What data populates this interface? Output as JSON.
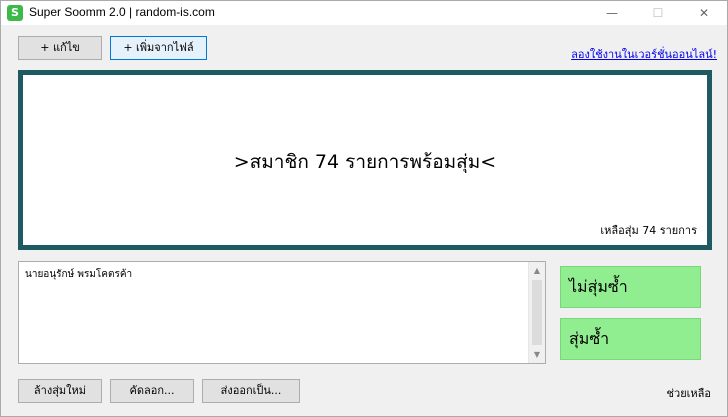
{
  "window": {
    "title": "Super Soomm 2.0 | random-is.com",
    "app_icon_glyph": "S",
    "minimize_glyph": "—",
    "maximize_glyph": "☐",
    "close_glyph": "✕"
  },
  "toolbar": {
    "edit_label": "+ แก้ไข",
    "add_from_file_label": "+ เพิ่มจากไฟล์",
    "try_online_link": "ลองใช้งานในเวอร์ชั่นออนไลน์!"
  },
  "display": {
    "message": ">สมาชิก 74 รายการพร้อมสุ่ม<",
    "remaining_text": "เหลือสุ่ม 74 รายการ"
  },
  "list": {
    "items": [
      "นายอนุรักษ์  พรมโคตรค้า"
    ],
    "scroll_up_glyph": "▲",
    "scroll_down_glyph": "▼"
  },
  "actions": {
    "no_duplicate_label": "ไม่สุ่มซ้ำ",
    "duplicate_label": "สุ่มซ้ำ"
  },
  "footer": {
    "reset_label": "ล้างสุ่มใหม่",
    "cut_label": "คัดลอก...",
    "export_label": "ส่งออกเป็น...",
    "help_label": "ช่วยเหลือ"
  },
  "colors": {
    "display_border": "#1f5a63",
    "green_button": "#90ee90",
    "link": "#0000ee"
  }
}
